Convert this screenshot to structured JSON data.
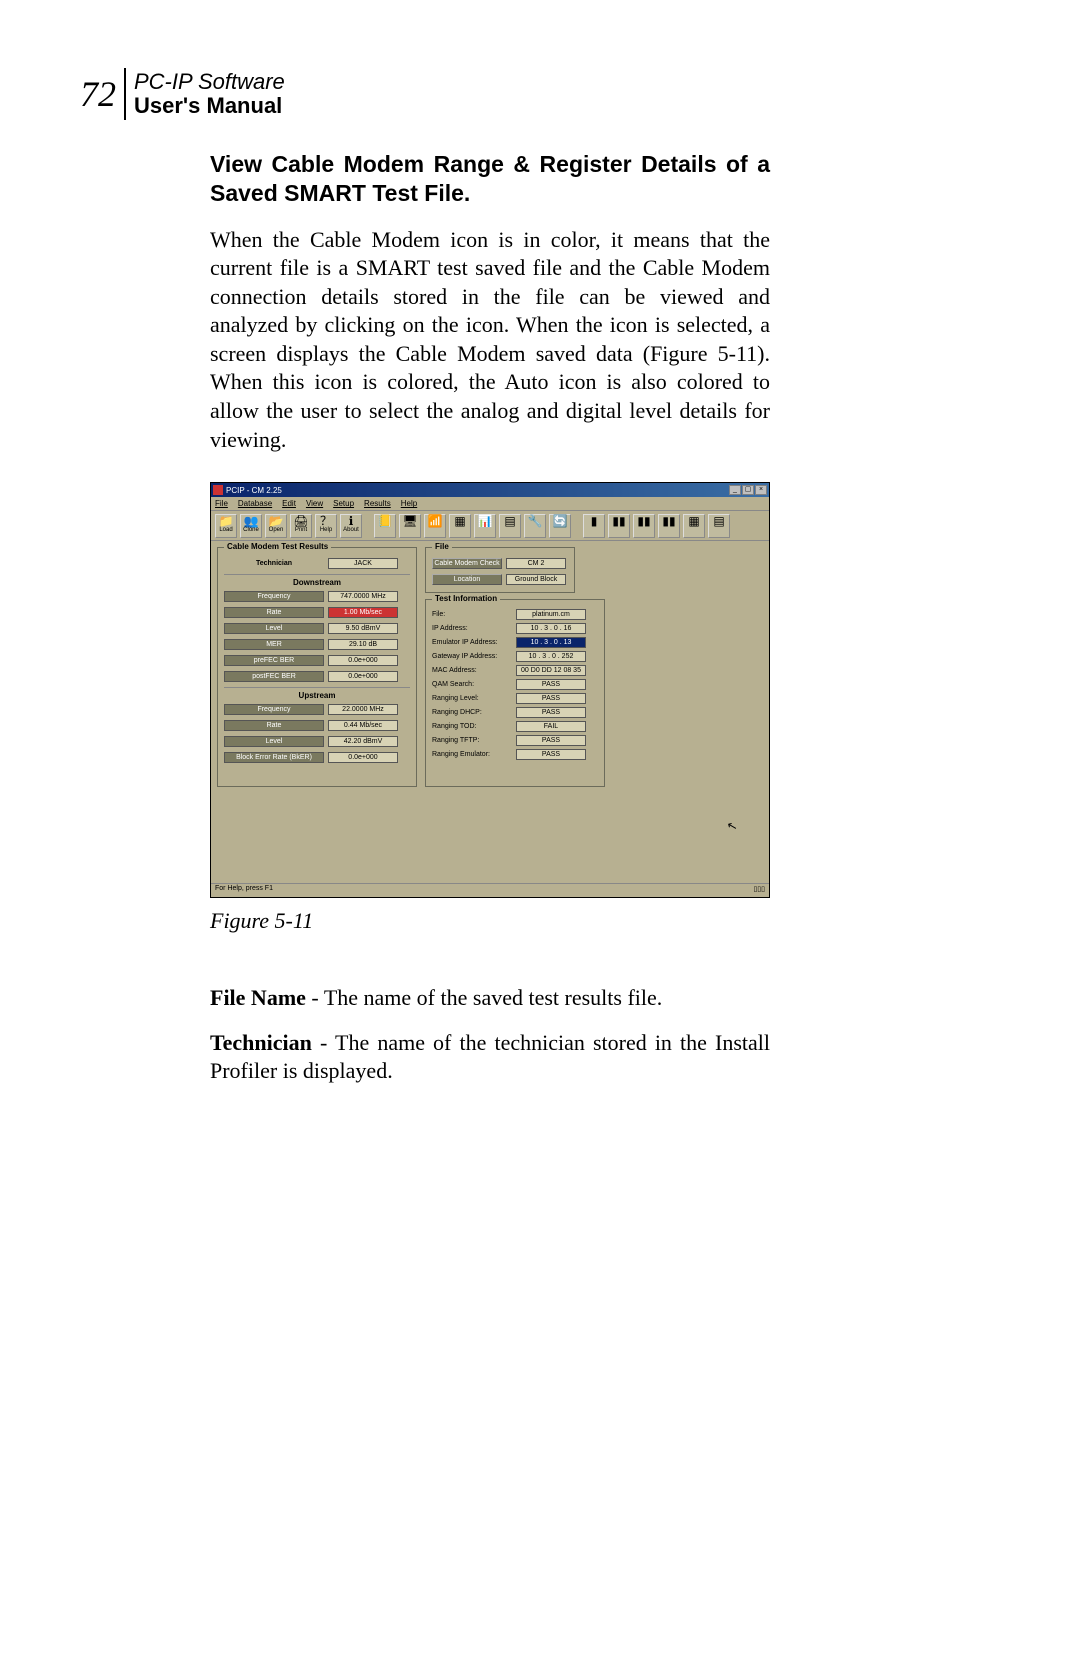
{
  "header": {
    "page_number": "72",
    "title_line1": "PC-IP Software",
    "title_line2": "User's Manual"
  },
  "section_heading": "View Cable Modem Range & Register Details of a Saved SMART Test File.",
  "body_paragraph": "When the Cable Modem icon is in color, it means that the current file is a SMART test saved file and the Cable Modem connection details stored in the file can be viewed and analyzed by clicking on the icon. When the icon is selected, a screen displays the Cable Modem saved data (Figure 5-11). When this icon is colored, the Auto icon is also colored to allow the user to select the analog and digital level details for viewing.",
  "figure_caption": "Figure 5-11",
  "definitions": [
    {
      "term": "File Name",
      "text": " - The name of the saved test results file."
    },
    {
      "term": "Technician",
      "text": " - The name of the technician stored in the Install Profiler is displayed."
    }
  ],
  "app": {
    "titlebar": "PCIP - CM 2.25",
    "window_buttons": {
      "min": "_",
      "max": "▢",
      "close": "×"
    },
    "menus": [
      "File",
      "Database",
      "Edit",
      "View",
      "Setup",
      "Results",
      "Help"
    ],
    "toolbar_labels": [
      "Load",
      "Clone",
      "Open",
      "Print",
      "Help",
      "About"
    ],
    "statusbar": "For Help, press F1",
    "results": {
      "legend": "Cable Modem Test Results",
      "technician_label": "Technician",
      "technician_value": "JACK",
      "downstream_label": "Downstream",
      "downstream": [
        {
          "label": "Frequency",
          "value": "747.0000 MHz"
        },
        {
          "label": "Rate",
          "value": "1.00 Mb/sec",
          "red": true
        },
        {
          "label": "Level",
          "value": "9.50 dBmV"
        },
        {
          "label": "MER",
          "value": "29.10 dB"
        },
        {
          "label": "preFEC BER",
          "value": "0.0e+000"
        },
        {
          "label": "postFEC BER",
          "value": "0.0e+000"
        }
      ],
      "upstream_label": "Upstream",
      "upstream": [
        {
          "label": "Frequency",
          "value": "22.0000 MHz"
        },
        {
          "label": "Rate",
          "value": "0.44 Mb/sec"
        },
        {
          "label": "Level",
          "value": "42.20 dBmV"
        },
        {
          "label": "Block Error Rate (BkER)",
          "value": "0.0e+000"
        }
      ]
    },
    "file_group": {
      "legend": "File",
      "rows": [
        {
          "label": "Cable Modem Check",
          "value": "CM 2"
        },
        {
          "label": "Location",
          "value": "Ground Block"
        }
      ]
    },
    "testinfo": {
      "legend": "Test Information",
      "rows": [
        {
          "label": "File:",
          "value": "platinum.cm"
        },
        {
          "label": "IP Address:",
          "value": "10 . 3 . 0 . 16"
        },
        {
          "label": "Emulator IP Address:",
          "value": "10 . 3 . 0 . 13",
          "selected": true
        },
        {
          "label": "Gateway IP Address:",
          "value": "10 . 3 . 0 . 252"
        },
        {
          "label": "MAC Address:",
          "value": "00 D0 DD 12 08 35"
        },
        {
          "label": "QAM Search:",
          "value": "PASS"
        },
        {
          "label": "Ranging Level:",
          "value": "PASS"
        },
        {
          "label": "Ranging DHCP:",
          "value": "PASS"
        },
        {
          "label": "Ranging TOD:",
          "value": "FAIL"
        },
        {
          "label": "Ranging TFTP:",
          "value": "PASS"
        },
        {
          "label": "Ranging Emulator:",
          "value": "PASS"
        }
      ]
    }
  }
}
